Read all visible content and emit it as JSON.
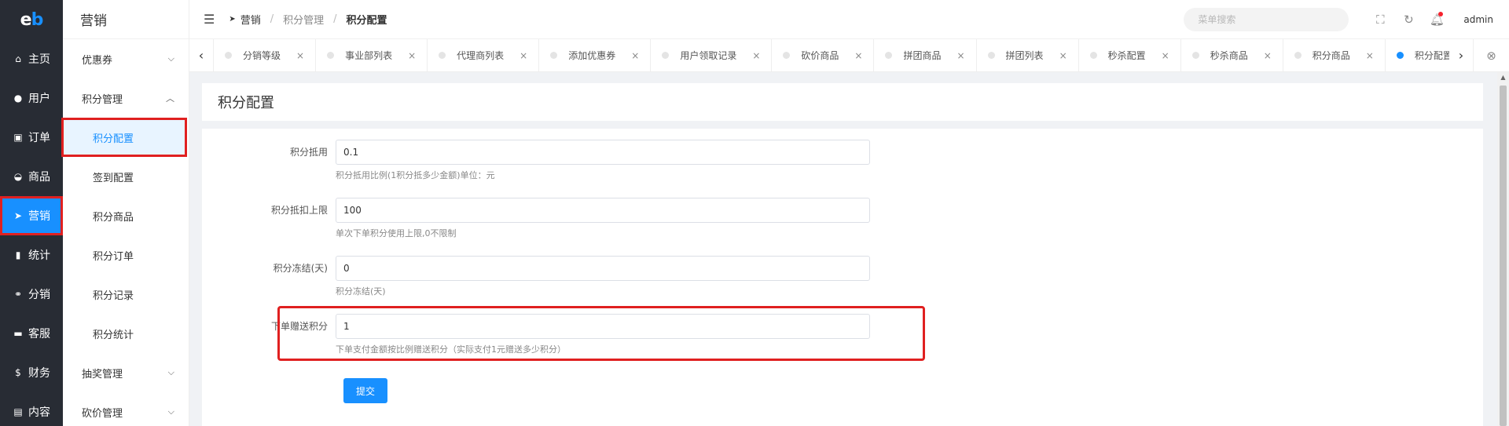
{
  "logo": {
    "e": "e",
    "b": "b"
  },
  "rail": [
    {
      "icon": "home-icon",
      "glyph": "⌂",
      "label": "主页",
      "active": false
    },
    {
      "icon": "user-icon",
      "glyph": "●",
      "label": "用户",
      "active": false
    },
    {
      "icon": "cart-icon",
      "glyph": "▣",
      "label": "订单",
      "active": false
    },
    {
      "icon": "basket-icon",
      "glyph": "◒",
      "label": "商品",
      "active": false
    },
    {
      "icon": "send-icon",
      "glyph": "➤",
      "label": "营销",
      "active": true
    },
    {
      "icon": "bar-chart-icon",
      "glyph": "▮",
      "label": "统计",
      "active": false
    },
    {
      "icon": "handshake-icon",
      "glyph": "⚭",
      "label": "分销",
      "active": false
    },
    {
      "icon": "chat-icon",
      "glyph": "▬",
      "label": "客服",
      "active": false
    },
    {
      "icon": "dollar-icon",
      "glyph": "$",
      "label": "财务",
      "active": false
    },
    {
      "icon": "book-icon",
      "glyph": "▤",
      "label": "内容",
      "active": false
    }
  ],
  "subnav": {
    "title": "营销",
    "coupon": "优惠券",
    "points_group": "积分管理",
    "points_children": [
      "积分配置",
      "签到配置",
      "积分商品",
      "积分订单",
      "积分记录",
      "积分统计"
    ],
    "lottery": "抽奖管理",
    "bargain": "砍价管理"
  },
  "header": {
    "breadcrumb": [
      "营销",
      "积分管理",
      "积分配置"
    ],
    "search_placeholder": "菜单搜索",
    "user": "admin"
  },
  "tabs": [
    "分销等级",
    "事业部列表",
    "代理商列表",
    "添加优惠券",
    "用户领取记录",
    "砍价商品",
    "拼团商品",
    "拼团列表",
    "秒杀配置",
    "秒杀商品",
    "积分商品",
    "积分配置"
  ],
  "page": {
    "title": "积分配置",
    "fields": [
      {
        "label": "积分抵用",
        "value": "0.1",
        "help": "积分抵用比例(1积分抵多少金额)单位：元"
      },
      {
        "label": "积分抵扣上限",
        "value": "100",
        "help": "单次下单积分使用上限,0不限制"
      },
      {
        "label": "积分冻结(天)",
        "value": "0",
        "help": "积分冻结(天)"
      },
      {
        "label": "下单赠送积分",
        "value": "1",
        "help": "下单支付金额按比例赠送积分（实际支付1元赠送多少积分）"
      }
    ],
    "submit": "提交"
  },
  "colors": {
    "primary": "#1890ff",
    "rail_bg": "#282c34",
    "highlight": "#e02020"
  }
}
